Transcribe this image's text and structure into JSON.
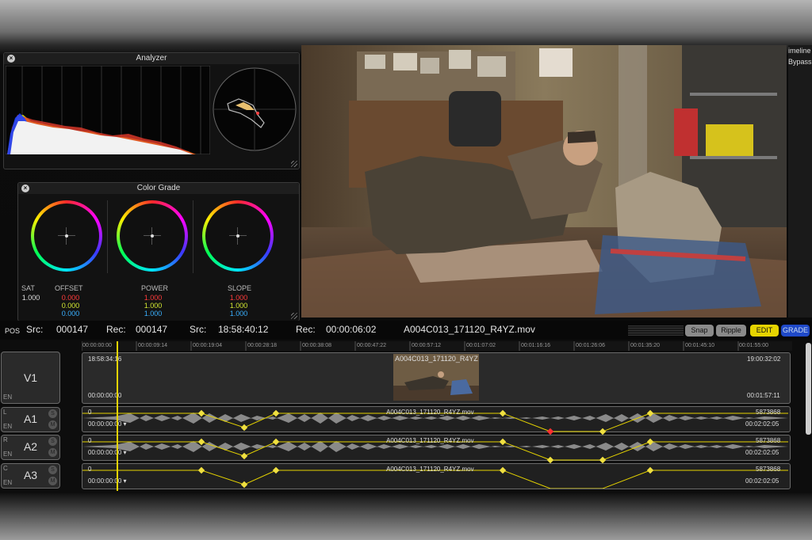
{
  "analyzer": {
    "title": "Analyzer"
  },
  "color_grade": {
    "title": "Color Grade",
    "sat_label": "SAT",
    "sat_value": "1.000",
    "wheels": [
      {
        "label": "OFFSET",
        "r": "0.000",
        "g": "0.000",
        "b": "0.000"
      },
      {
        "label": "POWER",
        "r": "1.000",
        "g": "1.000",
        "b": "1.000"
      },
      {
        "label": "SLOPE",
        "r": "1.000",
        "g": "1.000",
        "b": "1.000"
      }
    ]
  },
  "side_menu": {
    "item1": "imeline",
    "item2": "Bypass"
  },
  "toolbar": {
    "pos": "POS",
    "src_label": "Src:",
    "src_frame": "000147",
    "rec_label": "Rec:",
    "rec_frame": "000147",
    "src_tc_label": "Src:",
    "src_tc": "18:58:40:12",
    "rec_tc_label": "Rec:",
    "rec_tc": "00:00:06:02",
    "clip_name": "A004C013_171120_R4YZ.mov",
    "snap": "Snap",
    "ripple": "Ripple",
    "edit": "EDIT",
    "grade": "GRADE"
  },
  "ruler": [
    "00:00:00:00",
    "00:00:09:14",
    "00:00:19:04",
    "00:00:28:18",
    "00:00:38:08",
    "00:00:47:22",
    "00:00:57:12",
    "00:01:07:02",
    "00:01:16:16",
    "00:01:26:06",
    "00:01:35:20",
    "00:01:45:10",
    "00:01:55:00"
  ],
  "tracks": {
    "v1": {
      "name": "V1",
      "en": "EN",
      "tc_in": "18:58:34:16",
      "tc_out": "19:00:32:02",
      "start": "00:00:00:00",
      "end": "00:01:57:11",
      "clip": "A004C013_171120_R4YZ"
    },
    "a1": {
      "name": "A1",
      "side": "L",
      "en": "EN",
      "s": "S",
      "m": "M",
      "gain": "0",
      "clip": "A004C013_171120_R4YZ.mov",
      "samples": "5873868",
      "start": "00:00:00:00 ▾",
      "end": "00:02:02:05"
    },
    "a2": {
      "name": "A2",
      "side": "R",
      "en": "EN",
      "s": "S",
      "m": "M",
      "gain": "0",
      "clip": "A004C013_171120_R4YZ.mov",
      "samples": "5873868",
      "start": "00:00:00:00 ▾",
      "end": "00:02:02:05"
    },
    "a3": {
      "name": "A3",
      "side": "C",
      "en": "EN",
      "s": "S",
      "m": "M",
      "gain": "0",
      "clip": "A004C013_171120_R4YZ.mov",
      "samples": "5873868",
      "start": "00:00:00:00 ▾",
      "end": "00:02:02:05"
    }
  }
}
